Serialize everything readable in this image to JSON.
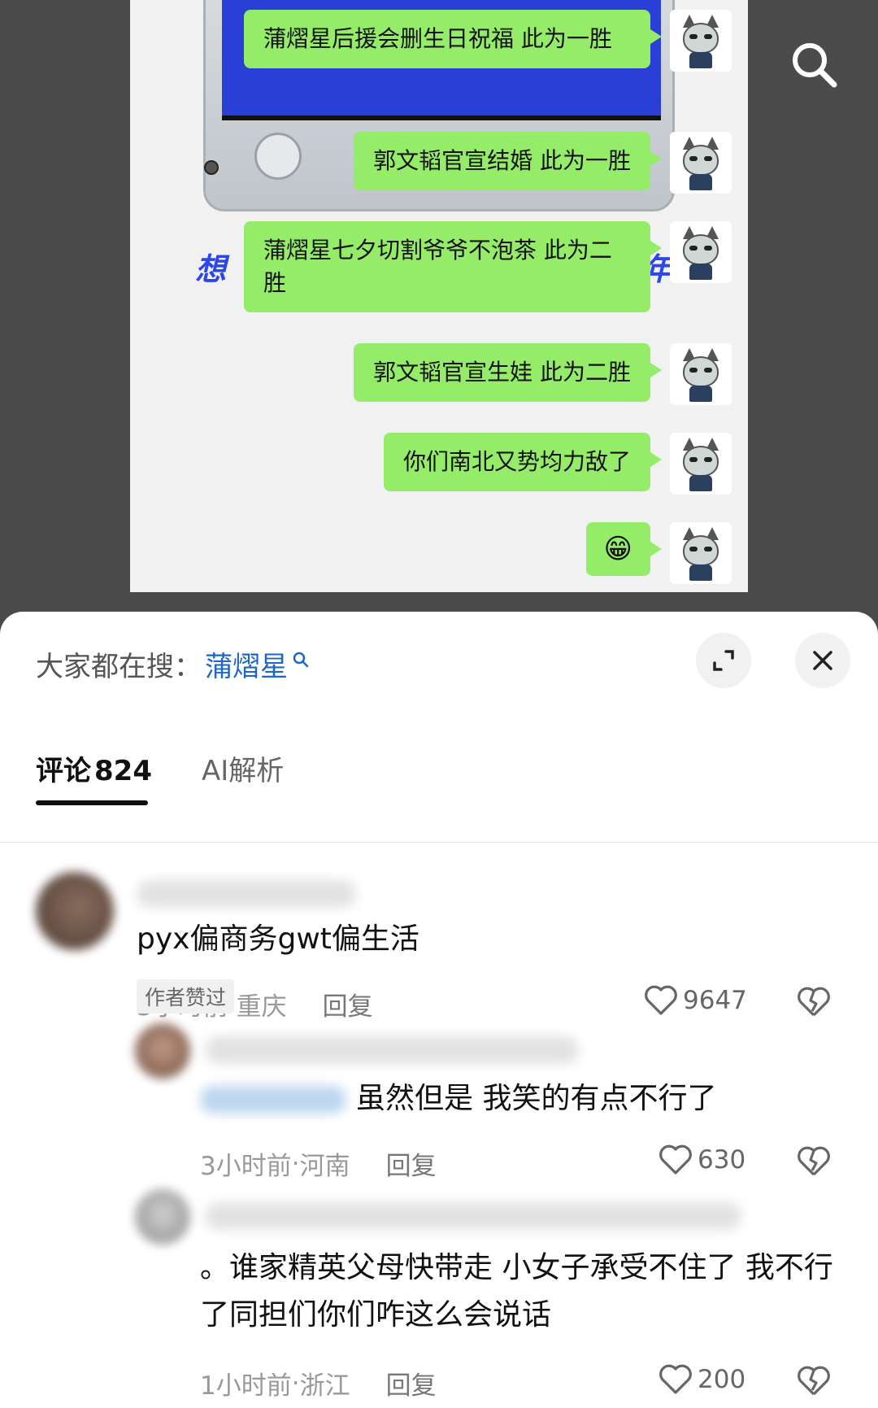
{
  "chat": {
    "messages": [
      {
        "text": "蒲熠星后援会删生日祝福 此为一胜"
      },
      {
        "text": "郭文韬官宣结婚 此为一胜"
      },
      {
        "text": "蒲熠星七夕切割爷爷不泡茶 此为二胜"
      },
      {
        "text": "郭文韬官宣生娃 此为二胜"
      },
      {
        "text": "你们南北又势均力敌了"
      },
      {
        "text": "😁"
      }
    ]
  },
  "sheet": {
    "hot_search_prefix": "大家都在搜：",
    "hot_search_keyword": "蒲熠星",
    "tabs": {
      "comments_label": "评论",
      "comments_count": "824",
      "ai_label": "AI解析"
    }
  },
  "comments": [
    {
      "text": "pyx偏商务gwt偏生活",
      "time": "3小时前",
      "location": "重庆",
      "reply_label": "回复",
      "likes": "9647"
    },
    {
      "badge": "作者赞过",
      "text": "虽然但是 我笑的有点不行了",
      "time": "3小时前",
      "location": "河南",
      "reply_label": "回复",
      "likes": "630"
    },
    {
      "text": "。谁家精英父母快带走 小女子承受不住了 我不行了同担们你们咋这么会说话",
      "time": "1小时前",
      "location": "浙江",
      "reply_label": "回复",
      "likes": "200"
    }
  ],
  "meta_separator": " · ",
  "colors": {
    "bubble": "#95ec69",
    "keyword": "#1f66c7",
    "promo_blue": "#2c47e8"
  }
}
